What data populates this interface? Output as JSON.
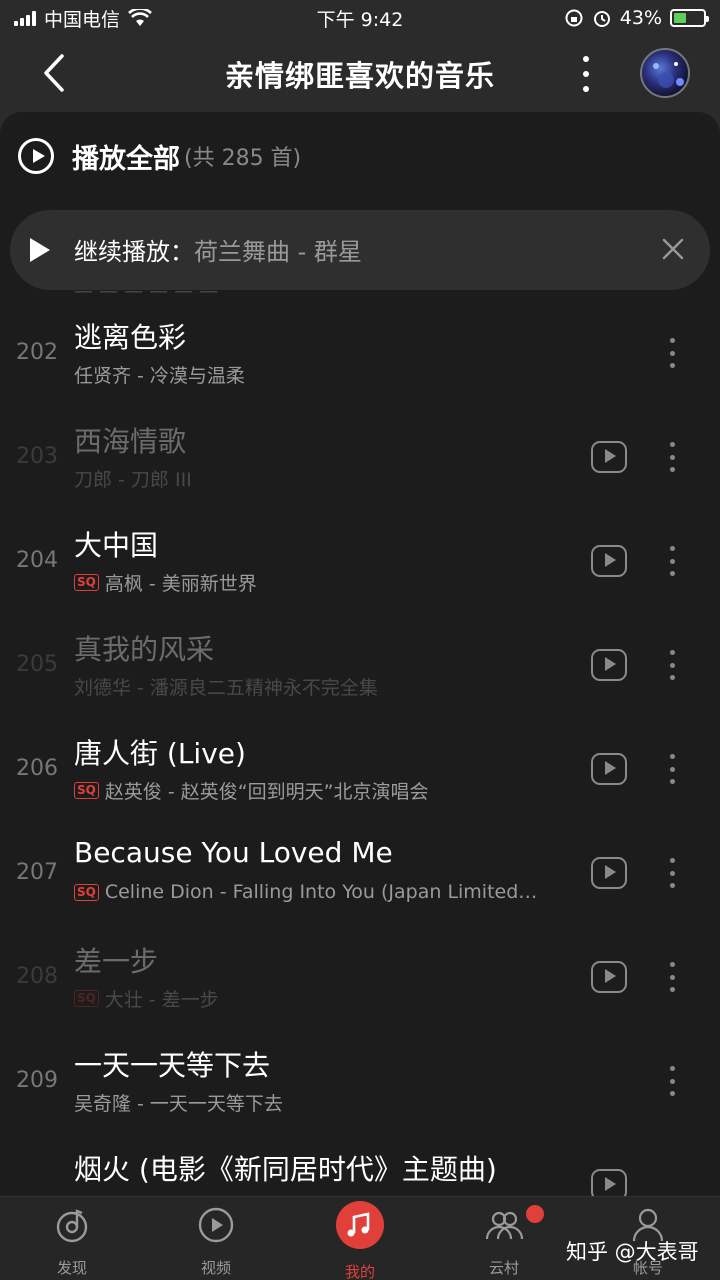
{
  "status_bar": {
    "carrier": "中国电信",
    "time": "下午 9:42",
    "battery": "43%",
    "battery_level": 0.43
  },
  "header": {
    "title": "亲情绑匪喜欢的音乐"
  },
  "play_all": {
    "label": "播放全部",
    "count": "(共 285 首)"
  },
  "resume": {
    "label": "继续播放：",
    "track": "荷兰舞曲 - 群星"
  },
  "songs": [
    {
      "num": "202",
      "title": "逃离色彩",
      "sq": "",
      "sub": "任贤齐 - 冷漠与温柔",
      "dim": false,
      "mv": false
    },
    {
      "num": "203",
      "title": "西海情歌",
      "sq": "",
      "sub": "刀郎 - 刀郎 III",
      "dim": true,
      "mv": true
    },
    {
      "num": "204",
      "title": "大中国",
      "sq": "SQ",
      "sub": "高枫 - 美丽新世界",
      "dim": false,
      "mv": true
    },
    {
      "num": "205",
      "title": "真我的风采",
      "sq": "",
      "sub": "刘德华 - 潘源良二五精神永不完全集",
      "dim": true,
      "mv": true
    },
    {
      "num": "206",
      "title": "唐人街 (Live)",
      "sq": "SQ",
      "sub": "赵英俊 - 赵英俊“回到明天”北京演唱会",
      "dim": false,
      "mv": true
    },
    {
      "num": "207",
      "title": "Because You Loved Me",
      "sq": "SQ",
      "sub": "Celine Dion - Falling Into You (Japan Limited…",
      "dim": false,
      "mv": true
    },
    {
      "num": "208",
      "title": "差一步",
      "sq": "SQ",
      "sub": "大壮 - 差一步",
      "dim": true,
      "mv": true
    },
    {
      "num": "209",
      "title": "一天一天等下去",
      "sq": "",
      "sub": "吴奇隆 - 一天一天等下去",
      "dim": false,
      "mv": false
    },
    {
      "num": "",
      "title": "烟火 (电影《新同居时代》主题曲)",
      "sq": "",
      "sub": "",
      "dim": false,
      "mv": true
    }
  ],
  "tabs": [
    {
      "label": "发现",
      "icon": "discover-icon"
    },
    {
      "label": "视频",
      "icon": "video-icon"
    },
    {
      "label": "我的",
      "icon": "music-note-icon"
    },
    {
      "label": "云村",
      "icon": "community-icon"
    },
    {
      "label": "帐号",
      "icon": "account-icon"
    }
  ],
  "watermark": "知乎 @大表哥",
  "colors": {
    "accent": "#e1403a",
    "background": "#1c1c1c"
  }
}
